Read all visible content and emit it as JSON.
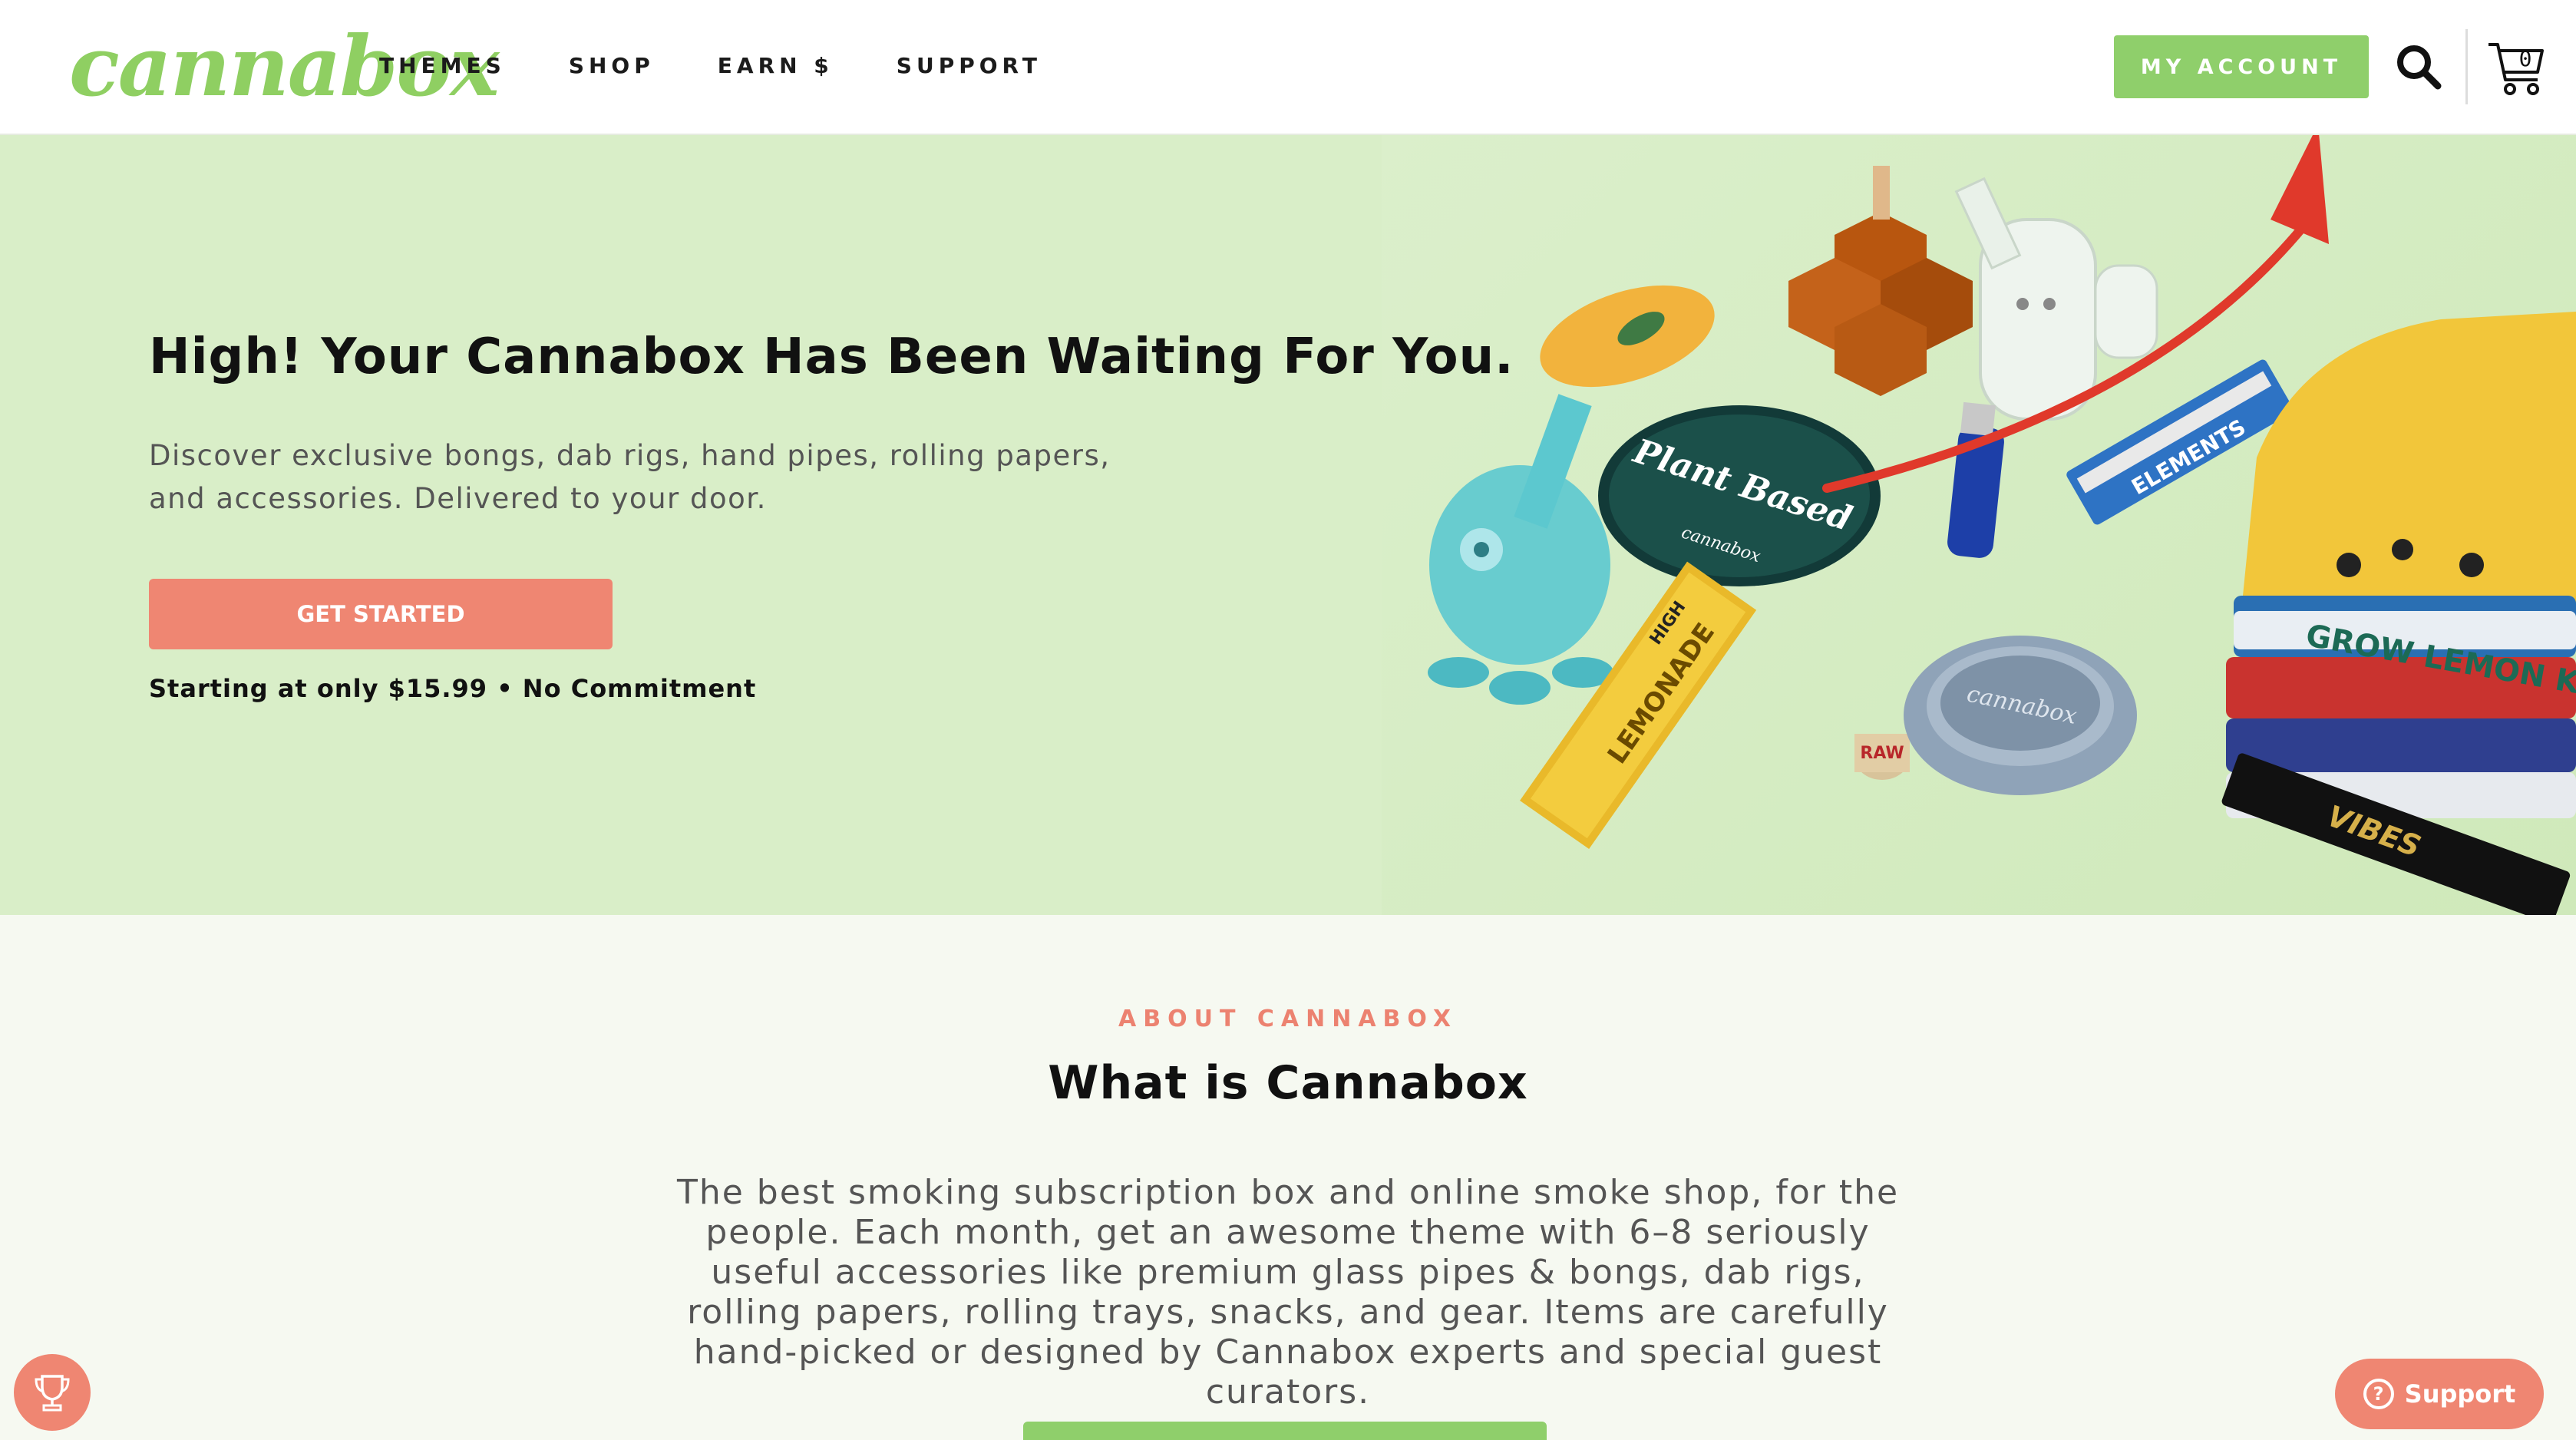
{
  "header": {
    "logo": "cannabox",
    "nav": [
      "THEMES",
      "SHOP",
      "EARN $",
      "SUPPORT"
    ],
    "account_label": "MY ACCOUNT",
    "cart_count": "0"
  },
  "hero": {
    "title": "High! Your Cannabox Has Been Waiting For You.",
    "description": "Discover exclusive bongs, dab rigs, hand pipes, rolling papers, and accessories. Delivered to your door.",
    "cta_label": "GET STARTED",
    "subtext": "Starting at only $15.99 • No Commitment",
    "image_labels": {
      "coaster": "Plant Based",
      "coaster_brand": "cannabox",
      "papers": "ELEMENTS",
      "wrap": "LEMONADE",
      "wrap_brand": "HIGH",
      "ashtray": "cannabox",
      "shirt": "GROW LEMON K",
      "tray": "VIBES",
      "tips": "RAW"
    }
  },
  "about": {
    "eyebrow": "ABOUT CANNABOX",
    "title": "What is Cannabox",
    "text": "The best smoking subscription box and online smoke shop, for the people. Each month, get an awesome theme with 6–8 seriously useful accessories like premium glass pipes & bongs, dab rigs, rolling papers, rolling trays, snacks, and gear. Items are carefully hand-picked or designed by Cannabox experts and special guest curators."
  },
  "widgets": {
    "support_label": "Support"
  },
  "colors": {
    "brand_green": "#8fcf6b",
    "accent_coral": "#ef8672",
    "hero_bg": "#d9eec8",
    "arrow_red": "#e0392b"
  }
}
